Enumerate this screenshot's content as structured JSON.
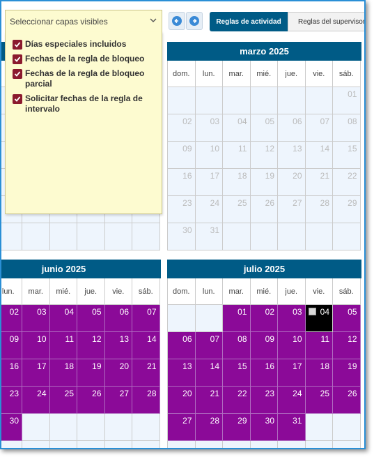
{
  "toolbar": {
    "layer_select_label": "Seleccionar capas visibles",
    "tabs": [
      "Reglas de actividad",
      "Reglas del supervisor"
    ]
  },
  "layers": [
    {
      "label": "Días especiales incluidos",
      "checked": true
    },
    {
      "label": "Fechas de la regla de bloqueo",
      "checked": true
    },
    {
      "label": "Fechas de la regla de bloqueo parcial",
      "checked": true
    },
    {
      "label": "Solicitar fechas de la regla de intervalo",
      "checked": true
    }
  ],
  "weekdays": [
    "dom.",
    "lun.",
    "mar.",
    "mié.",
    "jue.",
    "vie.",
    "sáb."
  ],
  "calendars": {
    "marzo": {
      "title": "marzo 2025"
    },
    "junio": {
      "title": "junio 2025"
    },
    "julio": {
      "title": "julio 2025"
    }
  },
  "colors": {
    "header": "#005b86",
    "activity": "#8b0a98",
    "selected": "#000000",
    "checkbox": "#8b1a2e"
  }
}
